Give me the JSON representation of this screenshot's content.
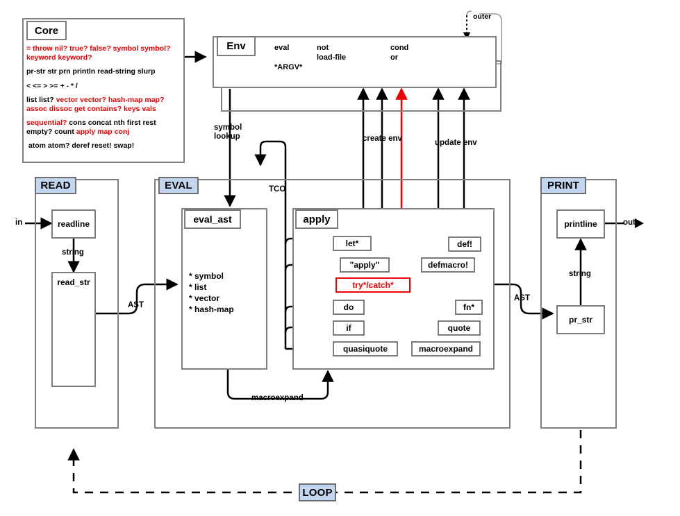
{
  "diagram": {
    "title": "MAL (Make a Lisp) architecture diagram",
    "accent_badge_color": "#c3d6ef",
    "error_color": "#ee0000",
    "border_color": "#808080"
  },
  "core": {
    "title": "Core",
    "groups": [
      {
        "id": "g1",
        "parts": [
          {
            "text": "= throw nil? true? false? symbol symbol? keyword keyword?",
            "color": "red"
          }
        ]
      },
      {
        "id": "g2",
        "parts": [
          {
            "text": "pr-str str prn println read-string slurp",
            "color": "black"
          }
        ]
      },
      {
        "id": "g3",
        "parts": [
          {
            "text": "< <= > >= + - * /",
            "color": "black"
          }
        ]
      },
      {
        "id": "g4",
        "parts": [
          {
            "text": "list list? ",
            "color": "black"
          },
          {
            "text": "vector vector? hash-map map? assoc dissoc get contains? keys vals",
            "color": "red"
          }
        ]
      },
      {
        "id": "g5",
        "parts": [
          {
            "text": "sequential?",
            "color": "red"
          },
          {
            "text": " cons concat nth first rest empty? count ",
            "color": "black"
          },
          {
            "text": "apply map conj",
            "color": "red"
          }
        ]
      },
      {
        "id": "g6",
        "parts": [
          {
            "text": " atom atom? deref reset! swap!",
            "color": "black"
          }
        ]
      }
    ]
  },
  "env": {
    "title": "Env",
    "outer_label": "outer",
    "columns": [
      {
        "id": "c1",
        "lines": [
          "eval",
          "",
          "*ARGV*"
        ]
      },
      {
        "id": "c2",
        "lines": [
          "not",
          "load-file"
        ]
      },
      {
        "id": "c3",
        "lines": [
          "cond",
          "or"
        ]
      }
    ]
  },
  "edges": {
    "symbol_lookup": "symbol\nlookup",
    "create_env": "create env",
    "update_env": "update env",
    "tco": "TCO",
    "macroexpand": "macroexpand",
    "ast_read_to_eval": "AST",
    "ast_eval_to_print": "AST",
    "string_read": "string",
    "string_print": "string",
    "in": "in",
    "out": "out"
  },
  "read": {
    "badge": "READ",
    "nodes": [
      {
        "id": "readline",
        "label": "readline"
      },
      {
        "id": "read_str",
        "label": "read_str"
      }
    ]
  },
  "eval": {
    "badge": "EVAL",
    "eval_ast": {
      "title": "eval_ast",
      "items": [
        "* symbol",
        "* list",
        "* vector",
        "* hash-map"
      ]
    },
    "apply": {
      "title": "apply",
      "tco_nodes": [
        {
          "id": "let",
          "label": "let*"
        },
        {
          "id": "apply_str",
          "label": "\"apply\""
        },
        {
          "id": "do",
          "label": "do"
        },
        {
          "id": "if",
          "label": "if"
        },
        {
          "id": "quasiquote",
          "label": "quasiquote"
        }
      ],
      "special_node": {
        "id": "trycatch",
        "label": "try*/catch*",
        "color": "#ee0000"
      },
      "other_nodes": [
        {
          "id": "def",
          "label": "def!"
        },
        {
          "id": "defmacro",
          "label": "defmacro!"
        },
        {
          "id": "fn",
          "label": "fn*"
        },
        {
          "id": "quote",
          "label": "quote"
        },
        {
          "id": "macroexpand",
          "label": "macroexpand"
        }
      ]
    }
  },
  "print": {
    "badge": "PRINT",
    "nodes": [
      {
        "id": "printline",
        "label": "printline"
      },
      {
        "id": "pr_str",
        "label": "pr_str"
      }
    ]
  },
  "loop": {
    "badge": "LOOP"
  }
}
